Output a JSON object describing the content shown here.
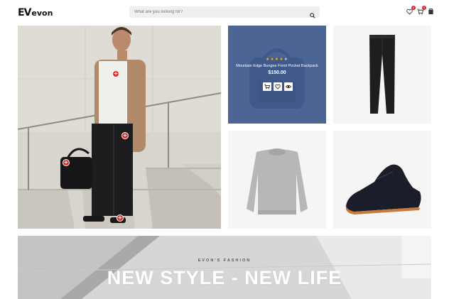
{
  "header": {
    "logo_mark": "EV",
    "logo_text": "evon",
    "search": {
      "placeholder": "What are you looking for?"
    },
    "icons": [
      {
        "name": "wishlist-icon",
        "badge": "0"
      },
      {
        "name": "cart-icon",
        "badge": "0"
      },
      {
        "name": "account-icon"
      }
    ]
  },
  "hero": {
    "hotspots": [
      "+",
      "+",
      "+",
      "+"
    ]
  },
  "featured_product": {
    "rating": 4,
    "rating_max": 5,
    "star_glyph": "★",
    "name": "Mountain Edge Bungee Front Pocket Backpack",
    "price": "$150.00",
    "actions": [
      "cart-icon",
      "heart-icon",
      "eye-icon"
    ]
  },
  "tiles": [
    {
      "name": "pants-product"
    },
    {
      "name": "sweater-product"
    },
    {
      "name": "shoe-product"
    }
  ],
  "banner": {
    "subtitle": "EVON'S FASHION",
    "title": "NEW STYLE - NEW LIFE"
  },
  "colors": {
    "accent": "#e02828",
    "feature_bg": "#4c6594",
    "star": "#f2b31b"
  }
}
